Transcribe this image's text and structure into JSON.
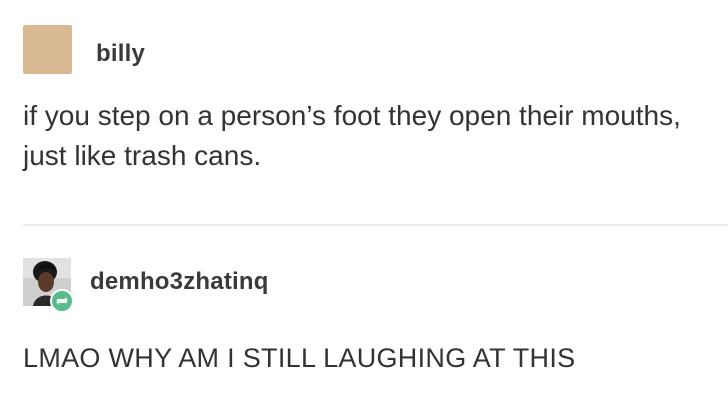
{
  "posts": [
    {
      "username": "billy",
      "avatar_color": "#d9b994",
      "avatar_icon": "blank-avatar-icon",
      "text": "if you step on a person’s foot they open their mouths, just like trash cans."
    },
    {
      "username": "demho3zhatinq",
      "avatar_icon": "profile-photo-icon",
      "badge_icon": "reblog-icon",
      "badge_color": "#56bc8a",
      "text": "LMAO WHY AM I STILL LAUGHING AT THIS"
    }
  ]
}
